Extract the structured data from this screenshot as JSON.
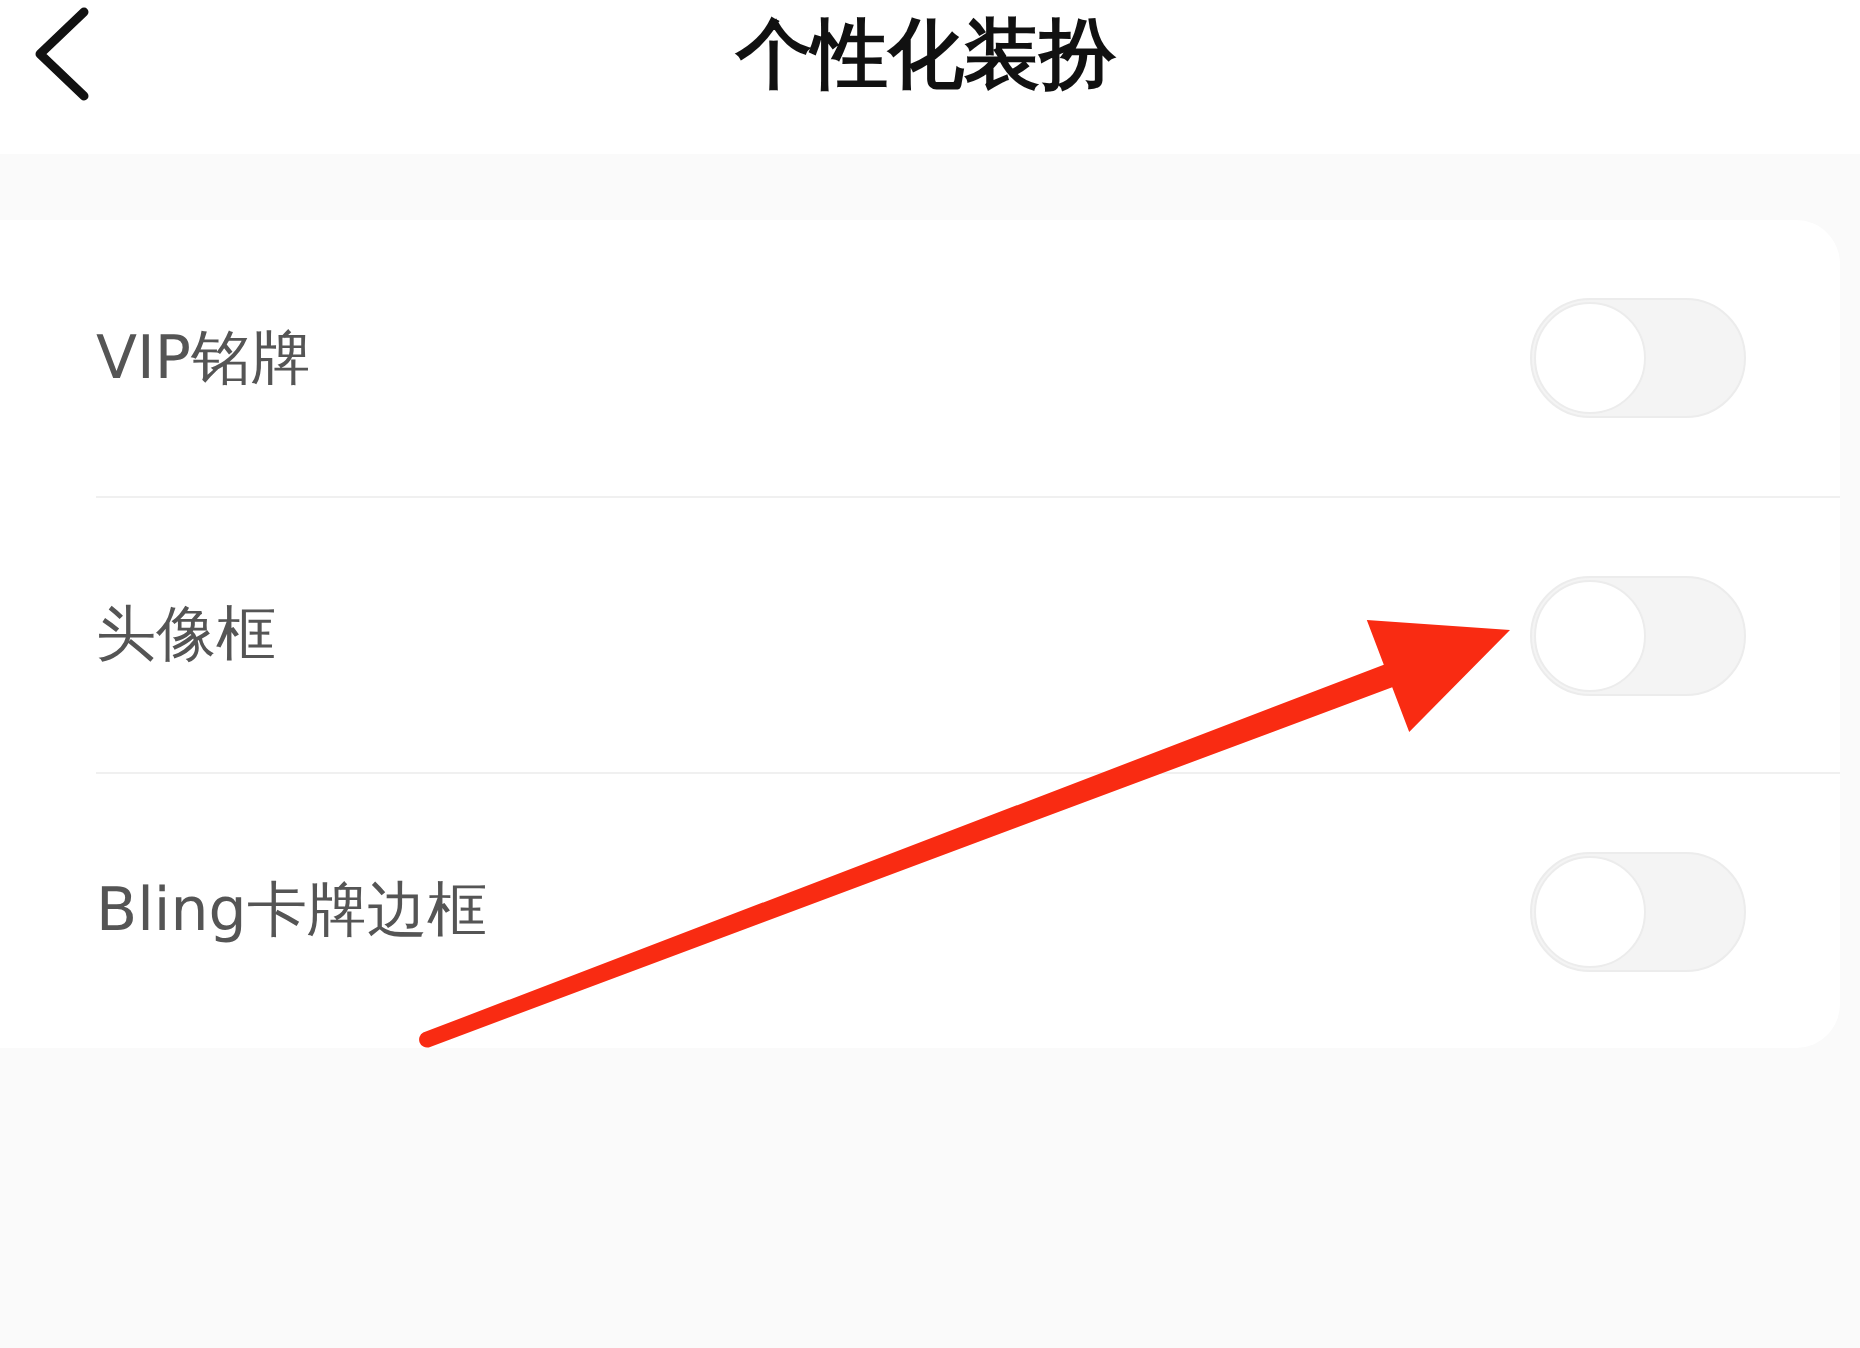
{
  "header": {
    "title": "个性化装扮"
  },
  "settings": [
    {
      "label": "VIP铭牌",
      "on": false
    },
    {
      "label": "头像框",
      "on": false
    },
    {
      "label": "Bling卡牌边框",
      "on": false
    }
  ]
}
